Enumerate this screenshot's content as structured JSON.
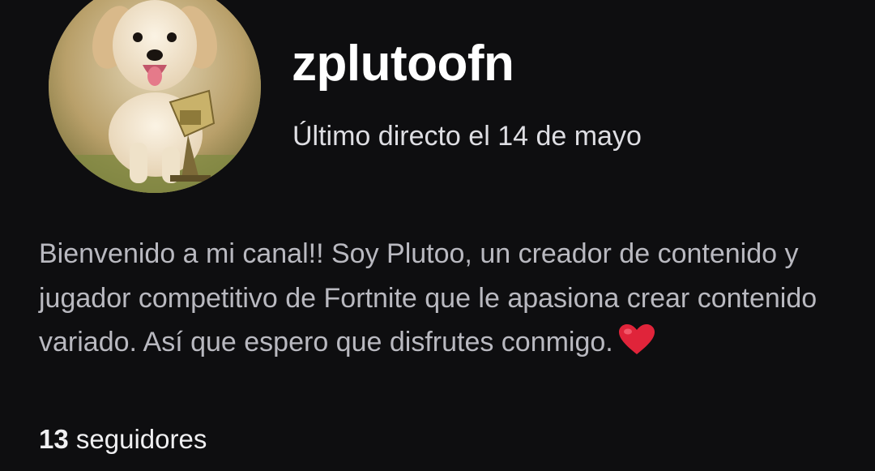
{
  "profile": {
    "channel_name": "zplutoofn",
    "last_live": "Último directo el 14 de mayo",
    "bio": "Bienvenido a mi canal!! Soy Plutoo, un creador de contenido y jugador competitivo de Fortnite que le apasiona crear contenido variado. Así que espero que disfrutes conmigo.",
    "bio_emoji_icon": "heart-icon",
    "followers_count": "13",
    "followers_label": "seguidores"
  },
  "colors": {
    "background": "#0e0e10",
    "name_text": "#ffffff",
    "bio_text": "#b9b9c0",
    "heart": "#e0243a"
  }
}
